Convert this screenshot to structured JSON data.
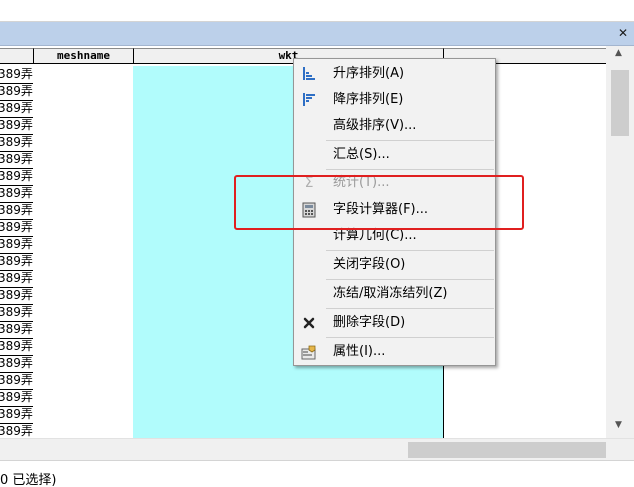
{
  "window": {
    "close_glyph": "✕"
  },
  "table": {
    "columns": [
      "",
      "meshname",
      "wkt"
    ],
    "prev_cell_text": "389弄",
    "row_count": 23
  },
  "context_menu": {
    "items": [
      {
        "label": "升序排列(A)",
        "icon": "sort-ascending-icon",
        "disabled": false
      },
      {
        "label": "降序排列(E)",
        "icon": "sort-descending-icon",
        "disabled": false
      },
      {
        "label": "高级排序(V)...",
        "icon": "",
        "disabled": false
      },
      {
        "label": "汇总(S)...",
        "icon": "",
        "disabled": false
      },
      {
        "label": "统计(T)...",
        "icon": "sigma-icon",
        "disabled": true
      },
      {
        "label": "字段计算器(F)...",
        "icon": "calculator-icon",
        "disabled": false
      },
      {
        "label": "计算几何(C)...",
        "icon": "",
        "disabled": false
      },
      {
        "label": "关闭字段(O)",
        "icon": "",
        "disabled": false
      },
      {
        "label": "冻结/取消冻结列(Z)",
        "icon": "",
        "disabled": false
      },
      {
        "label": "删除字段(D)",
        "icon": "delete-x-icon",
        "disabled": false
      },
      {
        "label": "属性(I)...",
        "icon": "properties-icon",
        "disabled": false
      }
    ]
  },
  "status": {
    "text": "0 已选择)"
  },
  "colors": {
    "selected_column": "#b1fcfc",
    "highlight": "#e01f1f",
    "titlebar": "#bcd0ea"
  }
}
